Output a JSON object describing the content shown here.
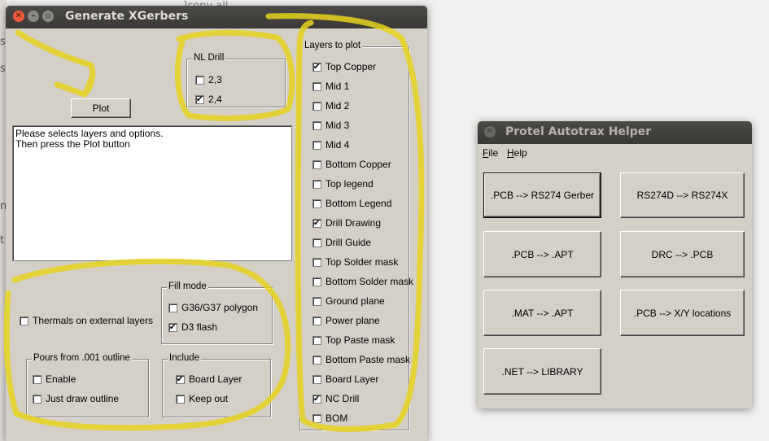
{
  "background": {
    "title_fragment": "]copy all",
    "edge_letters": [
      "s",
      "s",
      "n",
      "t"
    ]
  },
  "xgerbers": {
    "title": "Generate XGerbers",
    "plot_button": "Plot",
    "message_lines": [
      "Please selects layers and options.",
      "Then press the Plot button"
    ],
    "nl_drill": {
      "label": "NL Drill",
      "options": [
        {
          "label": "2,3",
          "checked": false
        },
        {
          "label": "2,4",
          "checked": true
        }
      ]
    },
    "thermals": {
      "label": "Thermals on external layers",
      "checked": false
    },
    "fill_mode": {
      "label": "Fill mode",
      "options": [
        {
          "label": "G36/G37 polygon",
          "checked": false
        },
        {
          "label": "D3 flash",
          "checked": true
        }
      ]
    },
    "pours": {
      "label": "Pours from .001 outline",
      "options": [
        {
          "label": "Enable",
          "checked": false
        },
        {
          "label": "Just draw outline",
          "checked": false
        }
      ]
    },
    "include": {
      "label": "Include",
      "options": [
        {
          "label": "Board Layer",
          "checked": true
        },
        {
          "label": "Keep out",
          "checked": false
        }
      ]
    },
    "layers": {
      "label": "Layers to plot",
      "items": [
        {
          "label": "Top Copper",
          "checked": true
        },
        {
          "label": "Mid 1",
          "checked": false
        },
        {
          "label": "Mid 2",
          "checked": false
        },
        {
          "label": "Mid 3",
          "checked": false
        },
        {
          "label": "Mid 4",
          "checked": false
        },
        {
          "label": "Bottom Copper",
          "checked": false
        },
        {
          "label": "Top legend",
          "checked": false
        },
        {
          "label": "Bottom Legend",
          "checked": false
        },
        {
          "label": "Drill Drawing",
          "checked": true
        },
        {
          "label": "Drill Guide",
          "checked": false
        },
        {
          "label": "Top Solder mask",
          "checked": false
        },
        {
          "label": "Bottom Solder mask",
          "checked": false
        },
        {
          "label": "Ground plane",
          "checked": false
        },
        {
          "label": "Power plane",
          "checked": false
        },
        {
          "label": "Top Paste mask",
          "checked": false
        },
        {
          "label": "Bottom Paste mask",
          "checked": false
        },
        {
          "label": "Board Layer",
          "checked": false
        },
        {
          "label": "NC Drill",
          "checked": true
        },
        {
          "label": "BOM",
          "checked": false
        }
      ]
    }
  },
  "helper": {
    "title": "Protel Autotrax Helper",
    "menu": [
      {
        "label": "File",
        "underline": "F",
        "rest": "ile"
      },
      {
        "label": "Help",
        "underline": "H",
        "rest": "elp"
      }
    ],
    "buttons": {
      "pcb_gerber": ".PCB --> RS274 Gerber",
      "rs274d_rs274x": "RS274D --> RS274X",
      "pcb_apt": ".PCB --> .APT",
      "drc_pcb": "DRC --> .PCB",
      "mat_apt": ".MAT --> .APT",
      "pcb_xy": ".PCB --> X/Y locations",
      "net_library": ".NET --> LIBRARY"
    }
  },
  "annotation_color": "#e6d31e"
}
